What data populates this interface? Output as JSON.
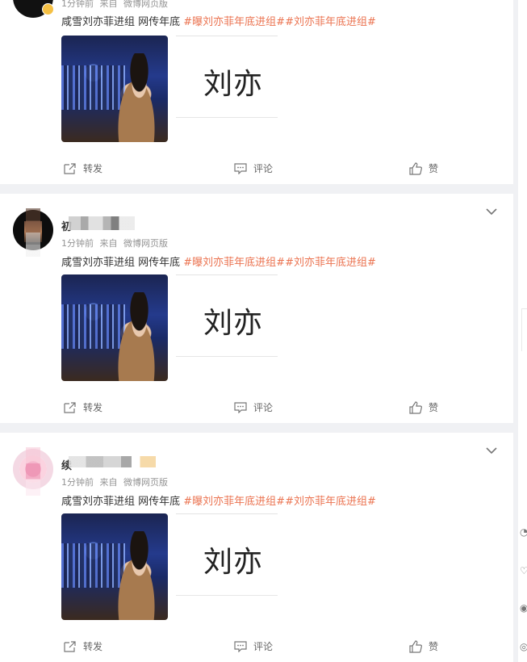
{
  "posts": [
    {
      "meta": {
        "time": "1分钟前",
        "from": "来自",
        "source": "微博网页版"
      },
      "text": "咸雪刘亦菲进组 网传年底",
      "topics": "#曝刘亦菲年底进组##刘亦菲年底进组#",
      "thumb_text": "刘亦",
      "actions": {
        "repost": "转发",
        "comment": "评论",
        "like": "赞"
      }
    },
    {
      "user_initial": "初",
      "meta": {
        "time": "1分钟前",
        "from": "来自",
        "source": "微博网页版"
      },
      "text": "咸雪刘亦菲进组 网传年底",
      "topics": "#曝刘亦菲年底进组##刘亦菲年底进组#",
      "thumb_text": "刘亦",
      "actions": {
        "repost": "转发",
        "comment": "评论",
        "like": "赞"
      }
    },
    {
      "user_initial": "续",
      "meta": {
        "time": "1分钟前",
        "from": "来自",
        "source": "微博网页版"
      },
      "text": "咸雪刘亦菲进组 网传年底",
      "topics": "#曝刘亦菲年底进组##刘亦菲年底进组#",
      "thumb_text": "刘亦",
      "actions": {
        "repost": "转发",
        "comment": "评论",
        "like": "赞"
      }
    }
  ],
  "colors": {
    "topic": "#eb7350",
    "meta": "#939393",
    "background": "#f0f1f4"
  },
  "icons": [
    "repost-icon",
    "comment-icon",
    "like-icon",
    "chevron-down-icon"
  ]
}
